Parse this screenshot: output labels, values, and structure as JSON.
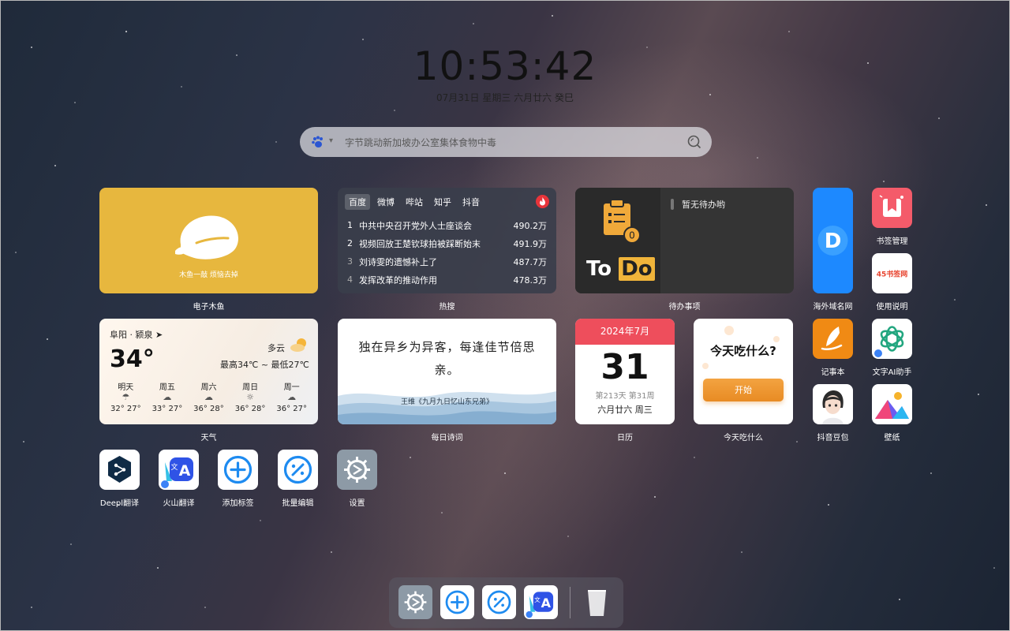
{
  "clock": {
    "time": "10:53:42",
    "date": "07月31日 星期三 六月廿六 癸巳"
  },
  "search": {
    "placeholder": "字节跳动新加坡办公室集体食物中毒",
    "engine_icon": "baidu-paw-icon"
  },
  "muyu": {
    "caption": "木鱼一敲 烦恼去掉",
    "label": "电子木鱼"
  },
  "hot": {
    "tabs": [
      "百度",
      "微博",
      "哔站",
      "知乎",
      "抖音"
    ],
    "active_tab": "百度",
    "items": [
      {
        "rank": "1",
        "title": "中共中央召开党外人士座谈会",
        "count": "490.2万"
      },
      {
        "rank": "2",
        "title": "视频回放王楚钦球拍被踩断始末",
        "count": "491.9万"
      },
      {
        "rank": "3",
        "title": "刘诗雯的遗憾补上了",
        "count": "487.7万"
      },
      {
        "rank": "4",
        "title": "发挥改革的推动作用",
        "count": "478.3万"
      }
    ],
    "label": "热搜"
  },
  "todo": {
    "badge": "0",
    "logo_to": "To",
    "logo_do": "Do",
    "empty": "暂无待办哟",
    "label": "待办事项"
  },
  "weather": {
    "city": "阜阳 · 颍泉",
    "temp": "34°",
    "condition": "多云",
    "range": "最高34℃ ~ 最低27℃",
    "forecast": [
      {
        "day": "明天",
        "temps": "32° 27°",
        "icon": "rain-icon"
      },
      {
        "day": "周五",
        "temps": "33° 27°",
        "icon": "partly-cloudy-icon"
      },
      {
        "day": "周六",
        "temps": "36° 28°",
        "icon": "partly-cloudy-icon"
      },
      {
        "day": "周日",
        "temps": "36° 28°",
        "icon": "sunny-icon"
      },
      {
        "day": "周一",
        "temps": "36° 27°",
        "icon": "partly-cloudy-icon"
      }
    ],
    "label": "天气"
  },
  "poem": {
    "text": "独在异乡为异客，每逢佳节倍思亲。",
    "author": "王维《九月九日忆山东兄弟》",
    "label": "每日诗词"
  },
  "calendar": {
    "month": "2024年7月",
    "day": "31",
    "info": "第213天 第31周",
    "lunar": "六月廿六 周三",
    "label": "日历"
  },
  "eat": {
    "question": "今天吃什么?",
    "button": "开始",
    "label": "今天吃什么"
  },
  "apps": [
    {
      "id": "domain",
      "label": "海外域名网"
    },
    {
      "id": "bookmark",
      "label": "书签管理"
    },
    {
      "id": "guide",
      "label": "使用说明",
      "logo_text": "45书签网"
    },
    {
      "id": "notepad",
      "label": "记事本"
    },
    {
      "id": "chatgpt",
      "label": "文字AI助手"
    },
    {
      "id": "doubao",
      "label": "抖音豆包"
    },
    {
      "id": "wallpaper",
      "label": "壁纸"
    },
    {
      "id": "deepl",
      "label": "Deepl翻译"
    },
    {
      "id": "volc",
      "label": "火山翻译"
    },
    {
      "id": "add",
      "label": "添加标签"
    },
    {
      "id": "batch",
      "label": "批量编辑"
    },
    {
      "id": "settings",
      "label": "设置"
    }
  ],
  "domain_letter": "D",
  "colors": {
    "accent_red": "#ee4e5c",
    "muyu_yellow": "#e7b73e",
    "orange": "#f08a24",
    "blue": "#1d89ff"
  }
}
